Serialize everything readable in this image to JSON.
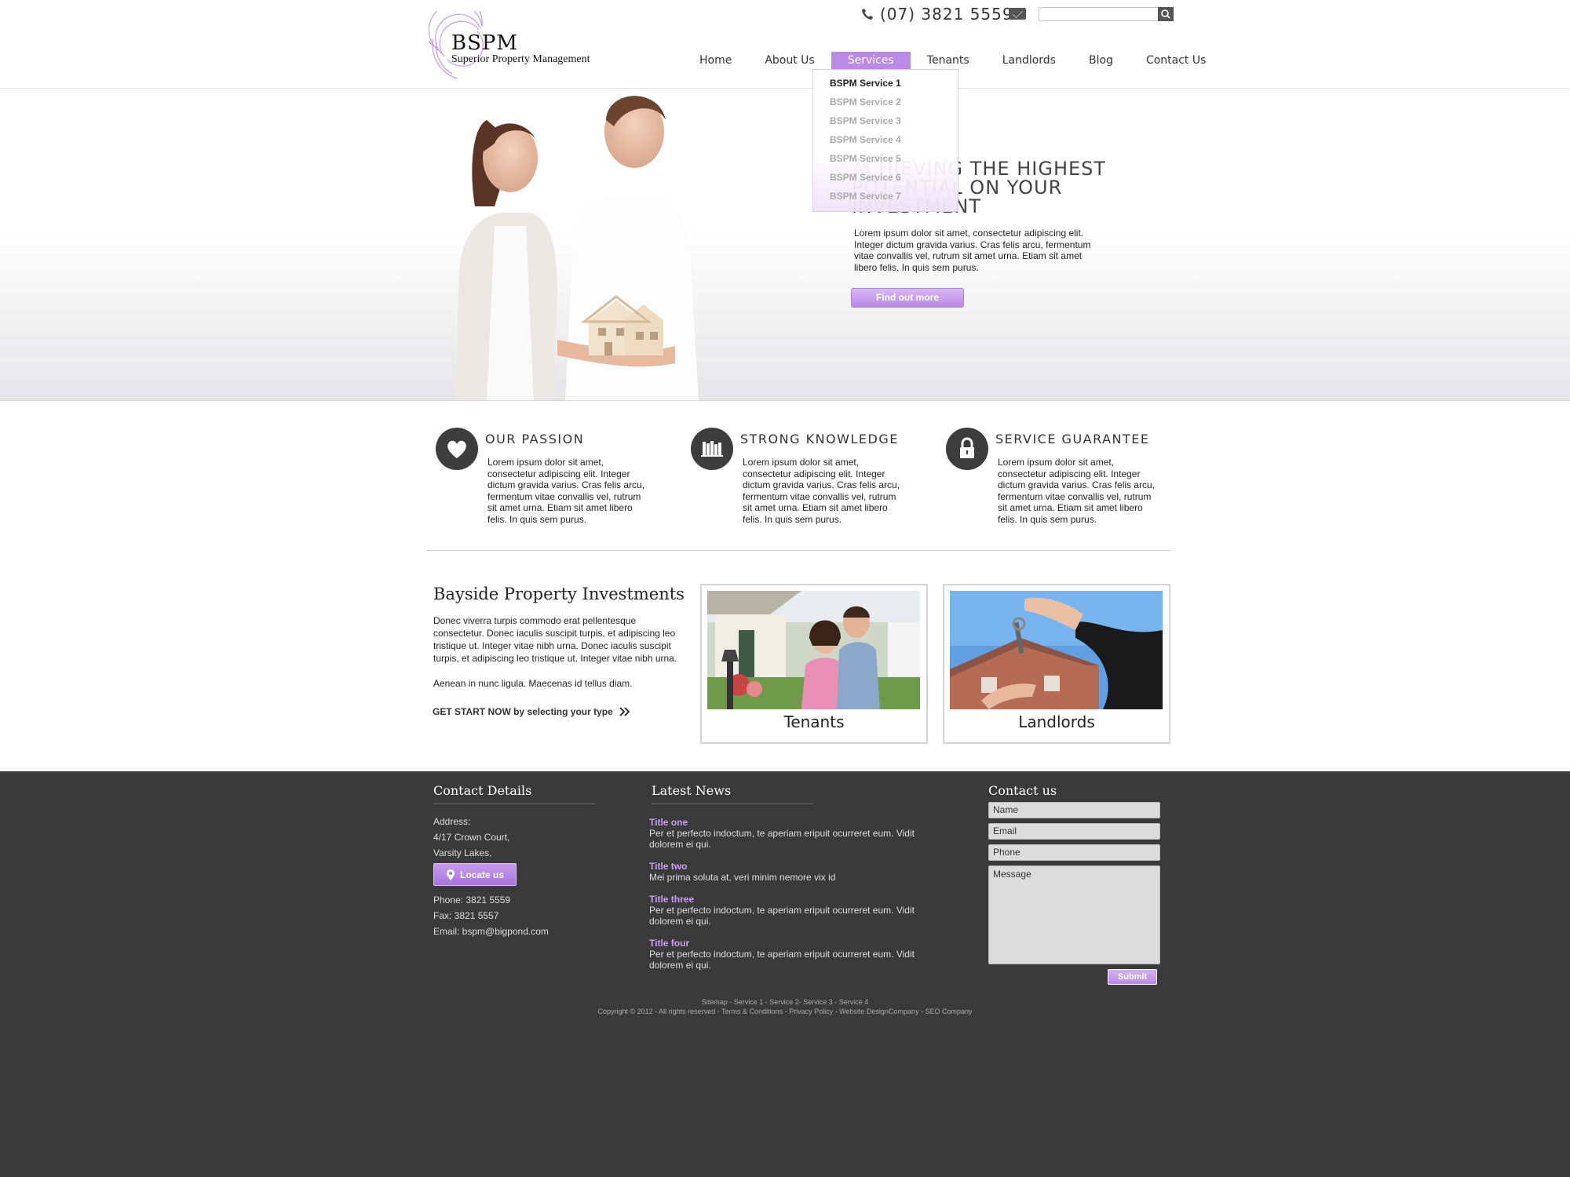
{
  "header": {
    "logo_text": "BSPM",
    "logo_subtitle": "Superior Property Management",
    "phone": "(07) 3821 5559",
    "search_placeholder": ""
  },
  "nav": {
    "items": [
      "Home",
      "About Us",
      "Services",
      "Tenants",
      "Landlords",
      "Blog",
      "Contact Us"
    ],
    "active": "Services",
    "dropdown": [
      "BSPM Service 1",
      "BSPM Service 2",
      "BSPM  Service 3",
      "BSPM  Service 4",
      "BSPM  Service 5",
      "BSPM  Service 6",
      "BSPM  Service 7"
    ]
  },
  "hero": {
    "title": "ACHIEVING THE HIGHEST POTENTIAL ON YOUR INVESTMENT",
    "text": "Lorem ipsum dolor sit amet, consectetur adipiscing elit. Integer dictum gravida varius. Cras felis arcu, fermentum vitae convallis vel, rutrum sit amet urna. Etiam sit amet libero felis. In quis sem purus.",
    "button": "Find out more"
  },
  "features": [
    {
      "title": "OUR PASSION",
      "icon": "heart-icon",
      "text": "Lorem ipsum dolor sit amet, consectetur adipiscing elit. Integer dictum gravida varius. Cras felis arcu, fermentum vitae convallis vel, rutrum sit amet urna. Etiam sit amet libero felis. In quis sem purus."
    },
    {
      "title": "STRONG KNOWLEDGE",
      "icon": "books-icon",
      "text": "Lorem ipsum dolor sit amet, consectetur adipiscing elit. Integer dictum gravida varius. Cras felis arcu, fermentum vitae convallis vel, rutrum sit amet urna. Etiam sit amet libero felis. In quis sem purus."
    },
    {
      "title": "SERVICE GUARANTEE",
      "icon": "lock-icon",
      "text": "Lorem ipsum dolor sit amet, consectetur adipiscing elit. Integer dictum gravida varius. Cras felis arcu, fermentum vitae convallis vel, rutrum sit amet urna. Etiam sit amet libero felis. In quis sem purus."
    }
  ],
  "bayside": {
    "title": "Bayside Property Investments",
    "text1": "Donec viverra turpis commodo erat pellentesque consectetur. Donec iaculis suscipit turpis, et adipiscing leo tristique ut. Integer vitae nibh urna.  Donec iaculis suscipit turpis, et adipiscing leo tristique ut. Integer vitae nibh urna.",
    "text2": "Aenean in nunc ligula. Maecenas id tellus diam.",
    "cta": "GET START NOW by selecting your type"
  },
  "cards": [
    {
      "label": "Tenants"
    },
    {
      "label": "Landlords"
    }
  ],
  "footer": {
    "contact_title": "Contact Details",
    "address_label": "Address:",
    "address_line1": "4/17 Crown Court,",
    "address_line2": "Varsity Lakes.",
    "locate_button": "Locate us",
    "phone": "Phone: 3821 5559",
    "fax": "Fax:  3821 5557",
    "email": "Email: bspm@bigpond.com",
    "news_title": "Latest News",
    "news": [
      {
        "title": "Title one",
        "text": "Per et perfecto indoctum, te aperiam eripuit ocurreret eum. Vidit dolorem ei qui."
      },
      {
        "title": "Title two",
        "text": "Mei prima soluta at, veri minim nemore vix id"
      },
      {
        "title": "Title three",
        "text": "Per et perfecto indoctum, te aperiam eripuit ocurreret eum. Vidit dolorem ei qui."
      },
      {
        "title": "Title four",
        "text": "Per et perfecto indoctum, te aperiam eripuit ocurreret eum. Vidit dolorem ei qui."
      }
    ],
    "form_title": "Contact us",
    "form": {
      "name": "Name",
      "email": "Email",
      "phone": "Phone",
      "message": "Message",
      "submit": "Submit"
    },
    "links": "Sitemap - Service 1 - Service 2- Service 3 - Service 4",
    "copyright": "Copyright ©  2012 - All rights reserved - Terms & Conditions  - Privacy Policy - Website DesignCompany - SEO Company"
  },
  "colors": {
    "accent": "#b98ae6",
    "footer_bg": "#3a3a3a",
    "news_title": "#c9a0f2"
  }
}
